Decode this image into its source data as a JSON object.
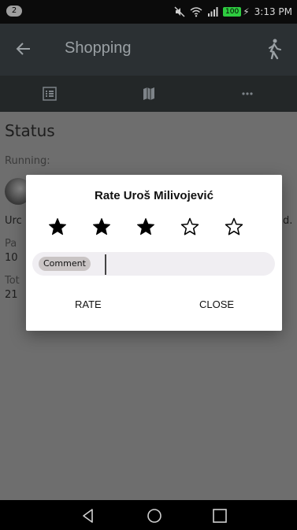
{
  "status_bar": {
    "notification_count": "2",
    "battery_level": "100",
    "time": "3:13 PM",
    "icons": [
      "mute-icon",
      "wifi-icon",
      "signal-icon",
      "battery-icon",
      "charging-icon"
    ]
  },
  "app_bar": {
    "title": "Shopping",
    "back_icon": "arrow-left-icon",
    "action_icon": "walking-person-icon"
  },
  "tabs": [
    {
      "icon": "list-icon"
    },
    {
      "icon": "map-icon"
    },
    {
      "icon": "more-horizontal-icon"
    }
  ],
  "content": {
    "section_title": "Status",
    "running_label": "Running:",
    "fragments": {
      "name_partial": "Urc",
      "right_partial": "d.",
      "label1_partial": "Pa",
      "value1_partial": "10",
      "label2_partial": "Tot",
      "value2_partial": "21"
    }
  },
  "dialog": {
    "title": "Rate Uroš Milivojević",
    "rating": 3,
    "max_rating": 5,
    "comment_label": "Comment",
    "comment_value": "",
    "rate_label": "RATE",
    "close_label": "CLOSE"
  },
  "colors": {
    "app_bar": "#2b3033",
    "tab_bar": "#232728",
    "content_bg": "#6e6e6e",
    "battery": "#2ecc40"
  }
}
